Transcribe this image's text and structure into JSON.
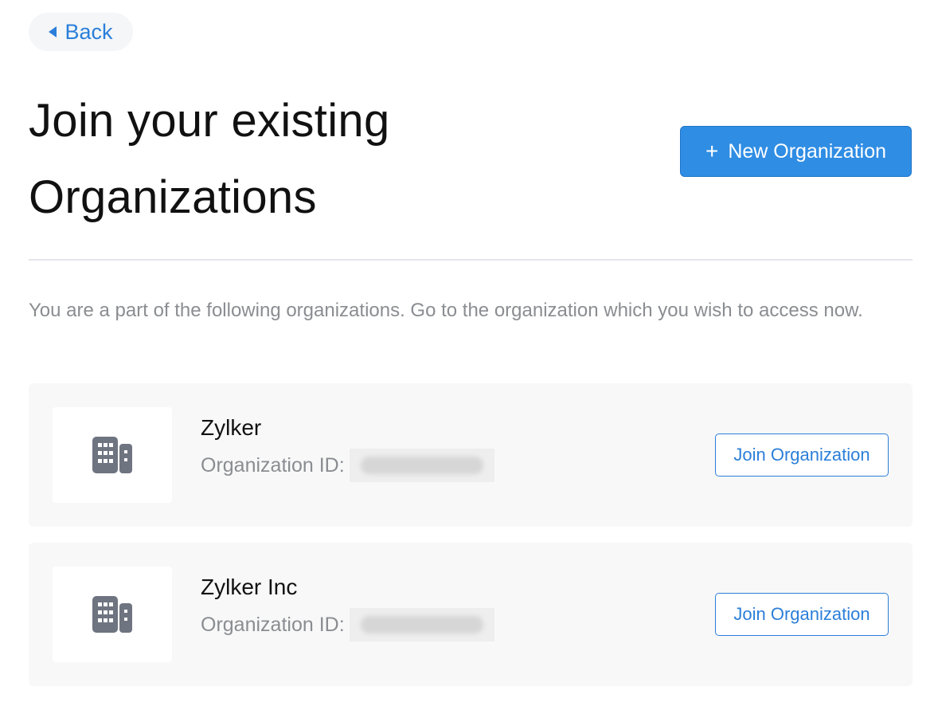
{
  "nav": {
    "back_label": "Back"
  },
  "header": {
    "title": "Join your existing Organizations",
    "new_org_label": "New Organization",
    "new_org_icon": "plus-icon"
  },
  "description": "You are a part of the following organizations. Go to the organization which you wish to access now.",
  "organizations": [
    {
      "name": "Zylker",
      "id_label": "Organization ID:",
      "icon": "building-icon",
      "join_label": "Join Organization"
    },
    {
      "name": "Zylker Inc",
      "id_label": "Organization ID:",
      "icon": "building-icon",
      "join_label": "Join Organization"
    }
  ],
  "colors": {
    "accent": "#2f8de4",
    "link": "#2b7fd9",
    "muted_text": "#8a8d91",
    "card_bg": "#f8f8f8",
    "icon": "#6e7480"
  }
}
